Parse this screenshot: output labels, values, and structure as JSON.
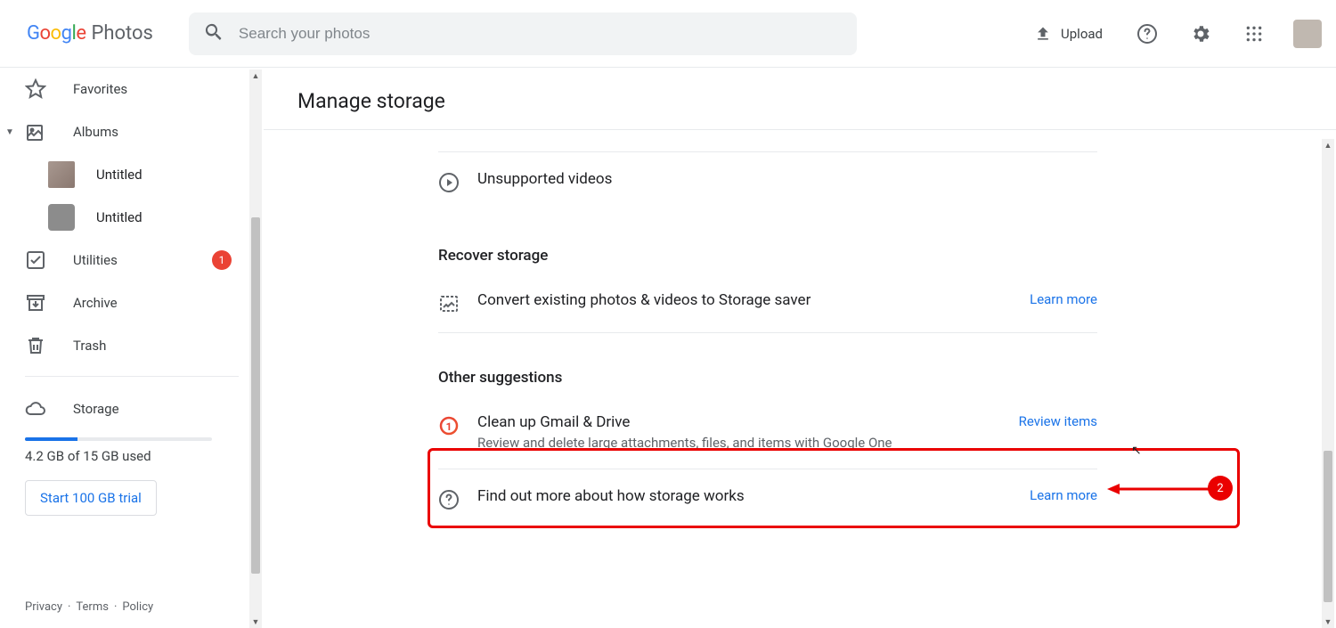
{
  "logo": {
    "g1": "G",
    "o1": "o",
    "o2": "o",
    "g2": "g",
    "l": "l",
    "e": "e",
    "suffix": "Photos"
  },
  "search": {
    "placeholder": "Search your photos"
  },
  "header": {
    "upload": "Upload"
  },
  "sidebar": {
    "favorites": "Favorites",
    "albums": "Albums",
    "album1": "Untitled",
    "album2": "Untitled",
    "utilities": "Utilities",
    "utilities_badge": "1",
    "archive": "Archive",
    "trash": "Trash",
    "storage": "Storage",
    "storage_used": "4.2 GB of 15 GB used",
    "trial": "Start 100 GB trial"
  },
  "footer": {
    "privacy": "Privacy",
    "terms": "Terms",
    "policy": "Policy"
  },
  "main": {
    "title": "Manage storage",
    "unsupported": "Unsupported videos",
    "recover_title": "Recover storage",
    "convert_title": "Convert existing photos & videos to Storage saver",
    "learn_more": "Learn more",
    "other_title": "Other suggestions",
    "cleanup_title": "Clean up Gmail & Drive",
    "cleanup_desc": "Review and delete large attachments, files, and items with Google One",
    "review": "Review items",
    "findout": "Find out more about how storage works"
  },
  "annotation": {
    "num": "2"
  }
}
